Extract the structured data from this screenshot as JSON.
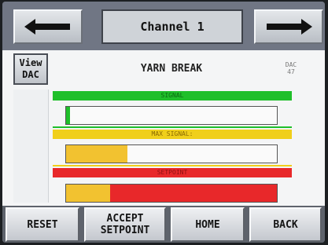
{
  "header": {
    "prev_icon": "arrow-left-icon",
    "next_icon": "arrow-right-icon",
    "channel_label": "Channel 1"
  },
  "view_dac": {
    "line1": "View",
    "line2": "DAC"
  },
  "page": {
    "title": "YARN BREAK",
    "dac_label": "DAC",
    "dac_value": "47"
  },
  "meters": [
    {
      "label": "SIGNAL",
      "band_color": "#1fbf2a",
      "fill_color": "#1fbf2a",
      "level": 0.02
    },
    {
      "label": "MAX SIGNAL:",
      "band_color": "#f0cf1b",
      "fill_color": "#f2c230",
      "level": 0.29
    },
    {
      "label": "SETPOINT",
      "band_color": "#e8282a",
      "fill_color": "#f2c230",
      "level": 0.21
    }
  ],
  "buttons": {
    "reset": "RESET",
    "accept": "ACCEPT\nSETPOINT",
    "home": "HOME",
    "back": "BACK"
  }
}
